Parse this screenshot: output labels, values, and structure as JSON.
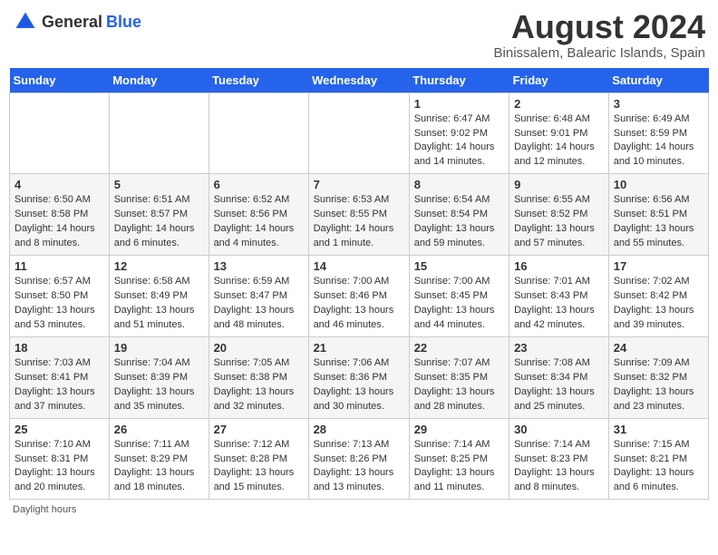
{
  "header": {
    "logo_general": "General",
    "logo_blue": "Blue",
    "title": "August 2024",
    "subtitle": "Binissalem, Balearic Islands, Spain"
  },
  "days_of_week": [
    "Sunday",
    "Monday",
    "Tuesday",
    "Wednesday",
    "Thursday",
    "Friday",
    "Saturday"
  ],
  "footnote": "Daylight hours",
  "weeks": [
    [
      {
        "day": "",
        "sunrise": "",
        "sunset": "",
        "daylight": ""
      },
      {
        "day": "",
        "sunrise": "",
        "sunset": "",
        "daylight": ""
      },
      {
        "day": "",
        "sunrise": "",
        "sunset": "",
        "daylight": ""
      },
      {
        "day": "",
        "sunrise": "",
        "sunset": "",
        "daylight": ""
      },
      {
        "day": "1",
        "sunrise": "Sunrise: 6:47 AM",
        "sunset": "Sunset: 9:02 PM",
        "daylight": "Daylight: 14 hours and 14 minutes."
      },
      {
        "day": "2",
        "sunrise": "Sunrise: 6:48 AM",
        "sunset": "Sunset: 9:01 PM",
        "daylight": "Daylight: 14 hours and 12 minutes."
      },
      {
        "day": "3",
        "sunrise": "Sunrise: 6:49 AM",
        "sunset": "Sunset: 8:59 PM",
        "daylight": "Daylight: 14 hours and 10 minutes."
      }
    ],
    [
      {
        "day": "4",
        "sunrise": "Sunrise: 6:50 AM",
        "sunset": "Sunset: 8:58 PM",
        "daylight": "Daylight: 14 hours and 8 minutes."
      },
      {
        "day": "5",
        "sunrise": "Sunrise: 6:51 AM",
        "sunset": "Sunset: 8:57 PM",
        "daylight": "Daylight: 14 hours and 6 minutes."
      },
      {
        "day": "6",
        "sunrise": "Sunrise: 6:52 AM",
        "sunset": "Sunset: 8:56 PM",
        "daylight": "Daylight: 14 hours and 4 minutes."
      },
      {
        "day": "7",
        "sunrise": "Sunrise: 6:53 AM",
        "sunset": "Sunset: 8:55 PM",
        "daylight": "Daylight: 14 hours and 1 minute."
      },
      {
        "day": "8",
        "sunrise": "Sunrise: 6:54 AM",
        "sunset": "Sunset: 8:54 PM",
        "daylight": "Daylight: 13 hours and 59 minutes."
      },
      {
        "day": "9",
        "sunrise": "Sunrise: 6:55 AM",
        "sunset": "Sunset: 8:52 PM",
        "daylight": "Daylight: 13 hours and 57 minutes."
      },
      {
        "day": "10",
        "sunrise": "Sunrise: 6:56 AM",
        "sunset": "Sunset: 8:51 PM",
        "daylight": "Daylight: 13 hours and 55 minutes."
      }
    ],
    [
      {
        "day": "11",
        "sunrise": "Sunrise: 6:57 AM",
        "sunset": "Sunset: 8:50 PM",
        "daylight": "Daylight: 13 hours and 53 minutes."
      },
      {
        "day": "12",
        "sunrise": "Sunrise: 6:58 AM",
        "sunset": "Sunset: 8:49 PM",
        "daylight": "Daylight: 13 hours and 51 minutes."
      },
      {
        "day": "13",
        "sunrise": "Sunrise: 6:59 AM",
        "sunset": "Sunset: 8:47 PM",
        "daylight": "Daylight: 13 hours and 48 minutes."
      },
      {
        "day": "14",
        "sunrise": "Sunrise: 7:00 AM",
        "sunset": "Sunset: 8:46 PM",
        "daylight": "Daylight: 13 hours and 46 minutes."
      },
      {
        "day": "15",
        "sunrise": "Sunrise: 7:00 AM",
        "sunset": "Sunset: 8:45 PM",
        "daylight": "Daylight: 13 hours and 44 minutes."
      },
      {
        "day": "16",
        "sunrise": "Sunrise: 7:01 AM",
        "sunset": "Sunset: 8:43 PM",
        "daylight": "Daylight: 13 hours and 42 minutes."
      },
      {
        "day": "17",
        "sunrise": "Sunrise: 7:02 AM",
        "sunset": "Sunset: 8:42 PM",
        "daylight": "Daylight: 13 hours and 39 minutes."
      }
    ],
    [
      {
        "day": "18",
        "sunrise": "Sunrise: 7:03 AM",
        "sunset": "Sunset: 8:41 PM",
        "daylight": "Daylight: 13 hours and 37 minutes."
      },
      {
        "day": "19",
        "sunrise": "Sunrise: 7:04 AM",
        "sunset": "Sunset: 8:39 PM",
        "daylight": "Daylight: 13 hours and 35 minutes."
      },
      {
        "day": "20",
        "sunrise": "Sunrise: 7:05 AM",
        "sunset": "Sunset: 8:38 PM",
        "daylight": "Daylight: 13 hours and 32 minutes."
      },
      {
        "day": "21",
        "sunrise": "Sunrise: 7:06 AM",
        "sunset": "Sunset: 8:36 PM",
        "daylight": "Daylight: 13 hours and 30 minutes."
      },
      {
        "day": "22",
        "sunrise": "Sunrise: 7:07 AM",
        "sunset": "Sunset: 8:35 PM",
        "daylight": "Daylight: 13 hours and 28 minutes."
      },
      {
        "day": "23",
        "sunrise": "Sunrise: 7:08 AM",
        "sunset": "Sunset: 8:34 PM",
        "daylight": "Daylight: 13 hours and 25 minutes."
      },
      {
        "day": "24",
        "sunrise": "Sunrise: 7:09 AM",
        "sunset": "Sunset: 8:32 PM",
        "daylight": "Daylight: 13 hours and 23 minutes."
      }
    ],
    [
      {
        "day": "25",
        "sunrise": "Sunrise: 7:10 AM",
        "sunset": "Sunset: 8:31 PM",
        "daylight": "Daylight: 13 hours and 20 minutes."
      },
      {
        "day": "26",
        "sunrise": "Sunrise: 7:11 AM",
        "sunset": "Sunset: 8:29 PM",
        "daylight": "Daylight: 13 hours and 18 minutes."
      },
      {
        "day": "27",
        "sunrise": "Sunrise: 7:12 AM",
        "sunset": "Sunset: 8:28 PM",
        "daylight": "Daylight: 13 hours and 15 minutes."
      },
      {
        "day": "28",
        "sunrise": "Sunrise: 7:13 AM",
        "sunset": "Sunset: 8:26 PM",
        "daylight": "Daylight: 13 hours and 13 minutes."
      },
      {
        "day": "29",
        "sunrise": "Sunrise: 7:14 AM",
        "sunset": "Sunset: 8:25 PM",
        "daylight": "Daylight: 13 hours and 11 minutes."
      },
      {
        "day": "30",
        "sunrise": "Sunrise: 7:14 AM",
        "sunset": "Sunset: 8:23 PM",
        "daylight": "Daylight: 13 hours and 8 minutes."
      },
      {
        "day": "31",
        "sunrise": "Sunrise: 7:15 AM",
        "sunset": "Sunset: 8:21 PM",
        "daylight": "Daylight: 13 hours and 6 minutes."
      }
    ]
  ]
}
